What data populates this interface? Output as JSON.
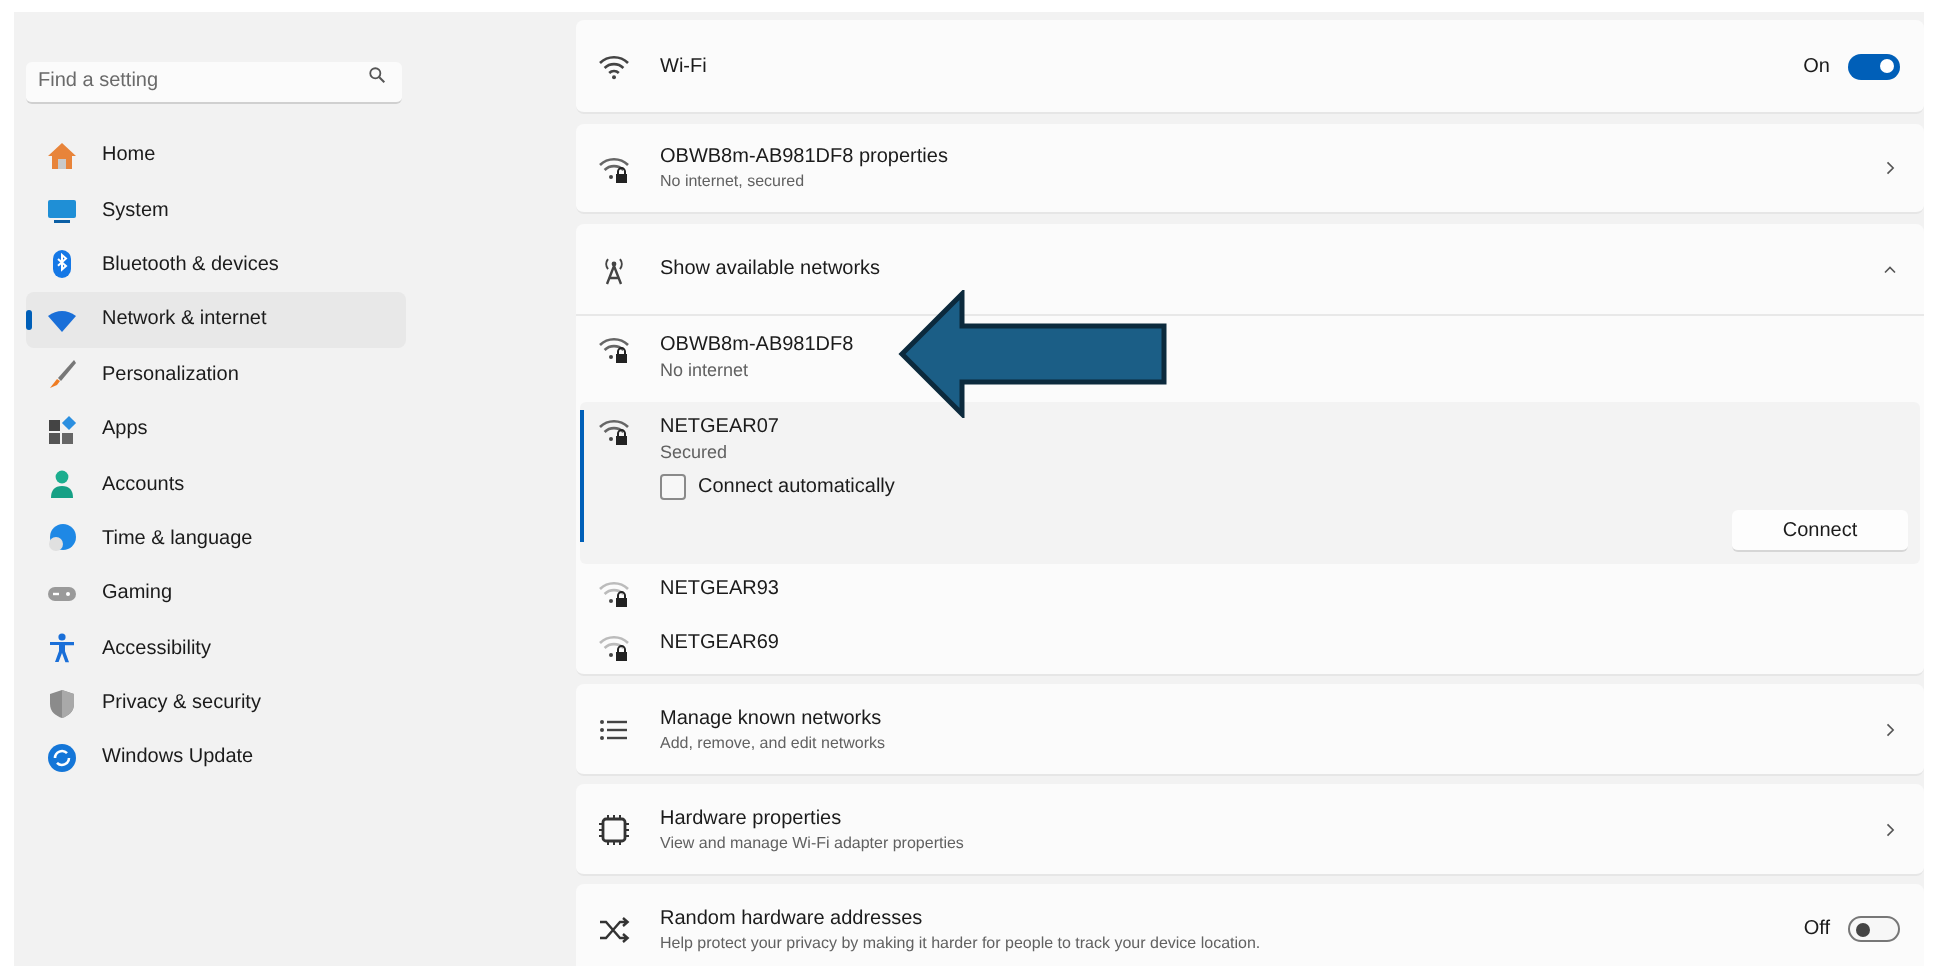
{
  "search": {
    "placeholder": "Find a setting"
  },
  "sidebar": {
    "items": [
      {
        "label": "Home",
        "selected": false
      },
      {
        "label": "System",
        "selected": false
      },
      {
        "label": "Bluetooth & devices",
        "selected": false
      },
      {
        "label": "Network & internet",
        "selected": true
      },
      {
        "label": "Personalization",
        "selected": false
      },
      {
        "label": "Apps",
        "selected": false
      },
      {
        "label": "Accounts",
        "selected": false
      },
      {
        "label": "Time & language",
        "selected": false
      },
      {
        "label": "Gaming",
        "selected": false
      },
      {
        "label": "Accessibility",
        "selected": false
      },
      {
        "label": "Privacy & security",
        "selected": false
      },
      {
        "label": "Windows Update",
        "selected": false
      }
    ]
  },
  "settings": [
    {
      "kind": "toggle",
      "title": "Wi-Fi",
      "state_label": "On",
      "on": true
    },
    {
      "kind": "link",
      "title": "OBWB8m-AB981DF8 properties",
      "subtitle": "No internet, secured"
    },
    {
      "kind": "expander",
      "title": "Show available networks",
      "expanded": true,
      "networks": [
        {
          "name": "OBWB8m-AB981DF8",
          "status": "No internet",
          "selected": false
        },
        {
          "name": "NETGEAR07",
          "status": "Secured",
          "selected": true,
          "connect_automatically": {
            "label": "Connect automatically",
            "checked": false
          },
          "button": "Connect"
        },
        {
          "name": "NETGEAR93",
          "selected": false
        },
        {
          "name": "NETGEAR69",
          "selected": false
        }
      ]
    },
    {
      "kind": "link",
      "title": "Manage known networks",
      "subtitle": "Add, remove, and edit networks"
    },
    {
      "kind": "link",
      "title": "Hardware properties",
      "subtitle": "View and manage Wi-Fi adapter properties"
    },
    {
      "kind": "toggle",
      "title": "Random hardware addresses",
      "subtitle": "Help protect your privacy by making it harder for people to track your device location.",
      "state_label": "Off",
      "on": false
    }
  ]
}
